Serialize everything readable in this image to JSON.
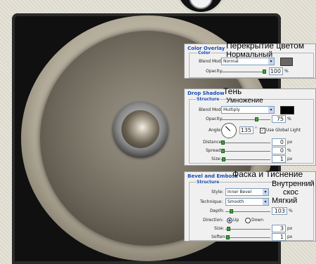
{
  "color_overlay": {
    "title": "Color Overlay",
    "group": "Color",
    "blend_mode_label": "Blend Mode:",
    "blend_mode": "Normal",
    "opacity_label": "Opacity:",
    "opacity": "100",
    "unit": "%",
    "swatch_color": "#6a6560"
  },
  "drop_shadow": {
    "title": "Drop Shadow",
    "group": "Structure",
    "blend_mode_label": "Blend Mode:",
    "blend_mode": "Multiply",
    "opacity_label": "Opacity:",
    "opacity": "75",
    "angle_label": "Angle:",
    "angle": "135",
    "degree": "°",
    "global_light_label": "Use Global Light",
    "distance_label": "Distance:",
    "distance": "0",
    "spread_label": "Spread:",
    "spread": "0",
    "size_label": "Size:",
    "size": "1",
    "unit_pct": "%",
    "unit_px": "px",
    "swatch_color": "#000000"
  },
  "bevel": {
    "title": "Bevel and Emboss",
    "group": "Structure",
    "style_label": "Style:",
    "style": "Inner Bevel",
    "technique_label": "Technique:",
    "technique": "Smooth",
    "depth_label": "Depth:",
    "depth": "103",
    "direction_label": "Direction:",
    "up": "Up",
    "down": "Down",
    "size_label": "Size:",
    "size": "3",
    "soften_label": "Soften:",
    "soften": "1",
    "unit_pct": "%",
    "unit_px": "px"
  },
  "annotations": {
    "color_overlay": "Перекрытие цветом",
    "normal": "Нормальный",
    "shadow": "Тень",
    "multiply": "Умножение",
    "bevel": "Фаска и Тиснение",
    "inner": "Внутренний",
    "bevel_word": "скос",
    "smooth": "Мягкий"
  }
}
